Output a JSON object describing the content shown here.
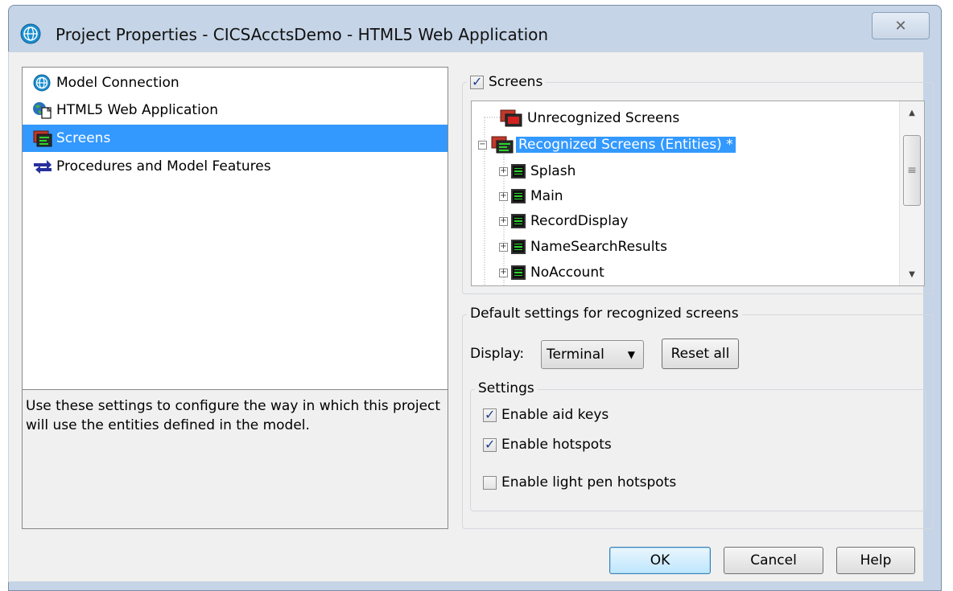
{
  "window": {
    "title": "Project Properties - CICSAcctsDemo - HTML5 Web Application",
    "close_symbol": "✕"
  },
  "nav": {
    "items": [
      {
        "label": "Model Connection",
        "icon": "globe-icon",
        "selected": false
      },
      {
        "label": "HTML5 Web Application",
        "icon": "web-app-icon",
        "selected": false
      },
      {
        "label": "Screens",
        "icon": "screens-icon",
        "selected": true
      },
      {
        "label": "Procedures and Model Features",
        "icon": "arrows-icon",
        "selected": false
      }
    ],
    "description": "Use these settings to configure the way in which this project will use the entities defined in the model."
  },
  "screens": {
    "group_label": "Screens",
    "enabled": true,
    "tree": {
      "unrecognized": "Unrecognized Screens",
      "recognized": "Recognized Screens (Entities) *",
      "entities": [
        "Splash",
        "Main",
        "RecordDisplay",
        "NameSearchResults",
        "NoAccount"
      ]
    }
  },
  "defaults": {
    "group_label": "Default settings for recognized screens",
    "display_label": "Display:",
    "display_value": "Terminal",
    "reset_label": "Reset all",
    "settings_label": "Settings",
    "options": [
      {
        "label": "Enable aid keys",
        "checked": true
      },
      {
        "label": "Enable hotspots",
        "checked": true
      },
      {
        "label": "Enable light pen hotspots",
        "checked": false
      }
    ]
  },
  "buttons": {
    "ok": "OK",
    "cancel": "Cancel",
    "help": "Help"
  }
}
